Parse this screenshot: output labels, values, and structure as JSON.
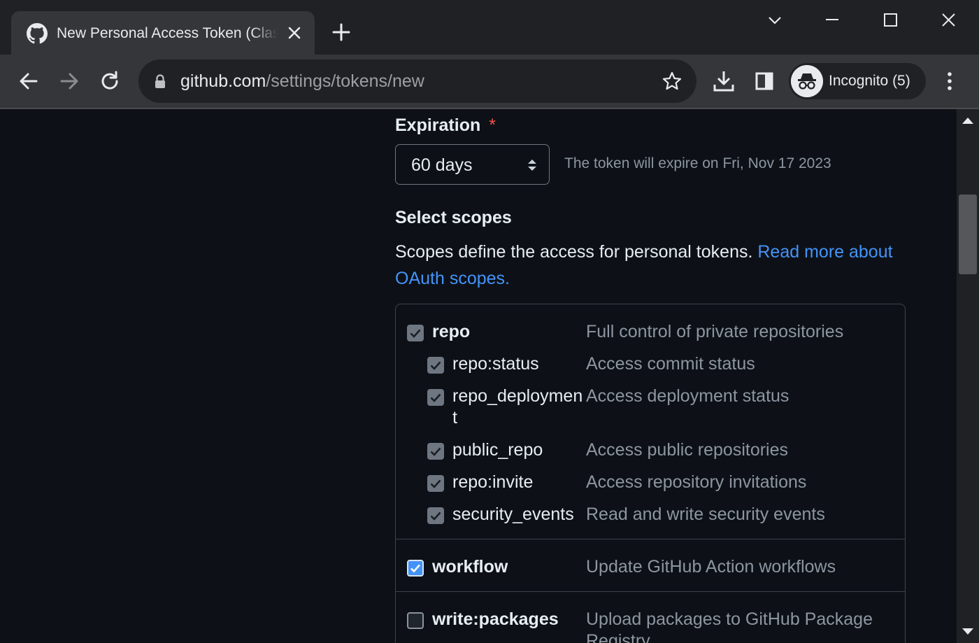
{
  "browser": {
    "tab_title": "New Personal Access Token (Classic)",
    "url_host": "github.com",
    "url_path": "/settings/tokens/new",
    "profile_label": "Incognito (5)"
  },
  "form": {
    "expiration_label": "Expiration",
    "required_marker": "*",
    "expiration_value": "60 days",
    "expiration_note": "The token will expire on Fri, Nov 17 2023",
    "scopes_title": "Select scopes",
    "scopes_desc": "Scopes define the access for personal tokens.",
    "scopes_link": "Read more about OAuth scopes."
  },
  "scopes": [
    {
      "name": "repo",
      "desc": "Full control of private repositories",
      "checked": true,
      "level": "parent"
    },
    {
      "name": "repo:status",
      "desc": "Access commit status",
      "checked": true,
      "level": "child"
    },
    {
      "name": "repo_deployment",
      "desc": "Access deployment status",
      "checked": true,
      "level": "child"
    },
    {
      "name": "public_repo",
      "desc": "Access public repositories",
      "checked": true,
      "level": "child"
    },
    {
      "name": "repo:invite",
      "desc": "Access repository invitations",
      "checked": true,
      "level": "child"
    },
    {
      "name": "security_events",
      "desc": "Read and write security events",
      "checked": true,
      "level": "child"
    },
    {
      "name": "workflow",
      "desc": "Update GitHub Action workflows",
      "checked": true,
      "level": "parent"
    },
    {
      "name": "write:packages",
      "desc": "Upload packages to GitHub Package Registry",
      "checked": false,
      "level": "parent"
    }
  ],
  "colors": {
    "accent": "#4493f8",
    "page_bg": "#0d1117",
    "required": "#f85149"
  }
}
